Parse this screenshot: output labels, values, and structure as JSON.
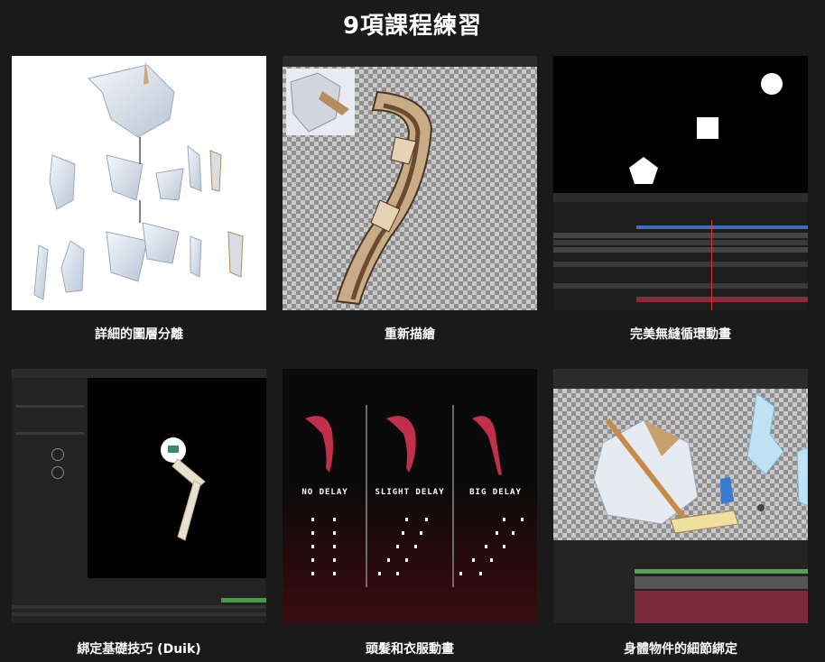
{
  "page": {
    "title": "9項課程練習"
  },
  "cards": [
    {
      "caption": "詳細的圖層分離"
    },
    {
      "caption": "重新描繪"
    },
    {
      "caption": "完美無縫循環動畫"
    },
    {
      "caption": "綁定基礎技巧 (Duik)"
    },
    {
      "caption": "頭髮和衣服動畫"
    },
    {
      "caption": "身體物件的細節綁定"
    }
  ],
  "delay_labels": [
    "NO DELAY",
    "SLIGHT DELAY",
    "BIG DELAY"
  ],
  "colors": {
    "background": "#1a1a1a",
    "text": "#ffffff",
    "hair_red": "#c0304a"
  }
}
